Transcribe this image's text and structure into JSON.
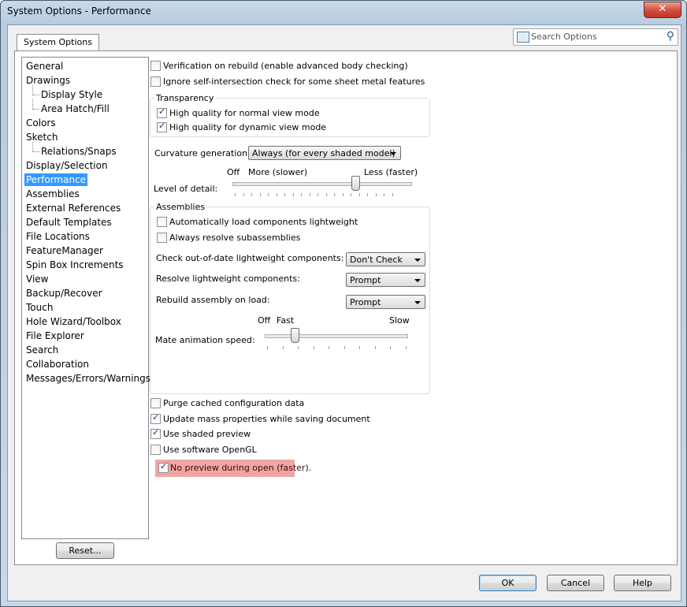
{
  "window": {
    "title": "System Options - Performance",
    "close_glyph": "✕"
  },
  "tab": {
    "label": "System Options"
  },
  "search": {
    "placeholder": "Search Options",
    "icon": "search-icon"
  },
  "tree": {
    "items": [
      {
        "label": "General",
        "level": 0
      },
      {
        "label": "Drawings",
        "level": 0
      },
      {
        "label": "Display Style",
        "level": 1
      },
      {
        "label": "Area Hatch/Fill",
        "level": 1
      },
      {
        "label": "Colors",
        "level": 0
      },
      {
        "label": "Sketch",
        "level": 0
      },
      {
        "label": "Relations/Snaps",
        "level": 1
      },
      {
        "label": "Display/Selection",
        "level": 0
      },
      {
        "label": "Performance",
        "level": 0,
        "selected": true
      },
      {
        "label": "Assemblies",
        "level": 0
      },
      {
        "label": "External References",
        "level": 0
      },
      {
        "label": "Default Templates",
        "level": 0
      },
      {
        "label": "File Locations",
        "level": 0
      },
      {
        "label": "FeatureManager",
        "level": 0
      },
      {
        "label": "Spin Box Increments",
        "level": 0
      },
      {
        "label": "View",
        "level": 0
      },
      {
        "label": "Backup/Recover",
        "level": 0
      },
      {
        "label": "Touch",
        "level": 0
      },
      {
        "label": "Hole Wizard/Toolbox",
        "level": 0
      },
      {
        "label": "File Explorer",
        "level": 0
      },
      {
        "label": "Search",
        "level": 0
      },
      {
        "label": "Collaboration",
        "level": 0
      },
      {
        "label": "Messages/Errors/Warnings",
        "level": 0
      }
    ]
  },
  "options": {
    "verification": {
      "label": "Verification on rebuild (enable advanced body checking)",
      "checked": false
    },
    "ignore_self": {
      "label": "Ignore self-intersection check for some sheet metal features",
      "checked": false
    },
    "transparency": {
      "title": "Transparency",
      "normal": {
        "label": "High quality for normal view mode",
        "checked": true
      },
      "dynamic": {
        "label": "High quality for dynamic view mode",
        "checked": true
      }
    },
    "curvature": {
      "label": "Curvature generation:",
      "value": "Always (for every shaded model)"
    },
    "lod": {
      "label": "Level of detail:",
      "off": "Off",
      "more": "More (slower)",
      "less": "Less (faster)",
      "level": 0.78
    },
    "assemblies": {
      "title": "Assemblies",
      "auto_light": {
        "label": "Automatically load components lightweight",
        "checked": false
      },
      "always_resolve": {
        "label": "Always resolve subassemblies",
        "checked": false
      },
      "check_outdated": {
        "label": "Check out-of-date lightweight components:",
        "value": "Don't Check"
      },
      "resolve_light": {
        "label": "Resolve lightweight components:",
        "value": "Prompt"
      },
      "rebuild_load": {
        "label": "Rebuild assembly on load:",
        "value": "Prompt"
      },
      "mate_anim": {
        "label": "Mate animation speed:",
        "off": "Off",
        "fast": "Fast",
        "slow": "Slow",
        "level": 0.2
      }
    },
    "purge": {
      "label": "Purge cached configuration data",
      "checked": false
    },
    "update_mass": {
      "label": "Update mass properties while saving document",
      "checked": true
    },
    "shaded_preview": {
      "label": "Use shaded preview",
      "checked": true
    },
    "software_opengl": {
      "label": "Use software OpenGL",
      "checked": false
    },
    "no_preview": {
      "label": "No preview during open (faster).",
      "checked": true,
      "highlight": "#ef8d8f"
    }
  },
  "buttons": {
    "reset": "Reset...",
    "ok": "OK",
    "cancel": "Cancel",
    "help": "Help"
  }
}
